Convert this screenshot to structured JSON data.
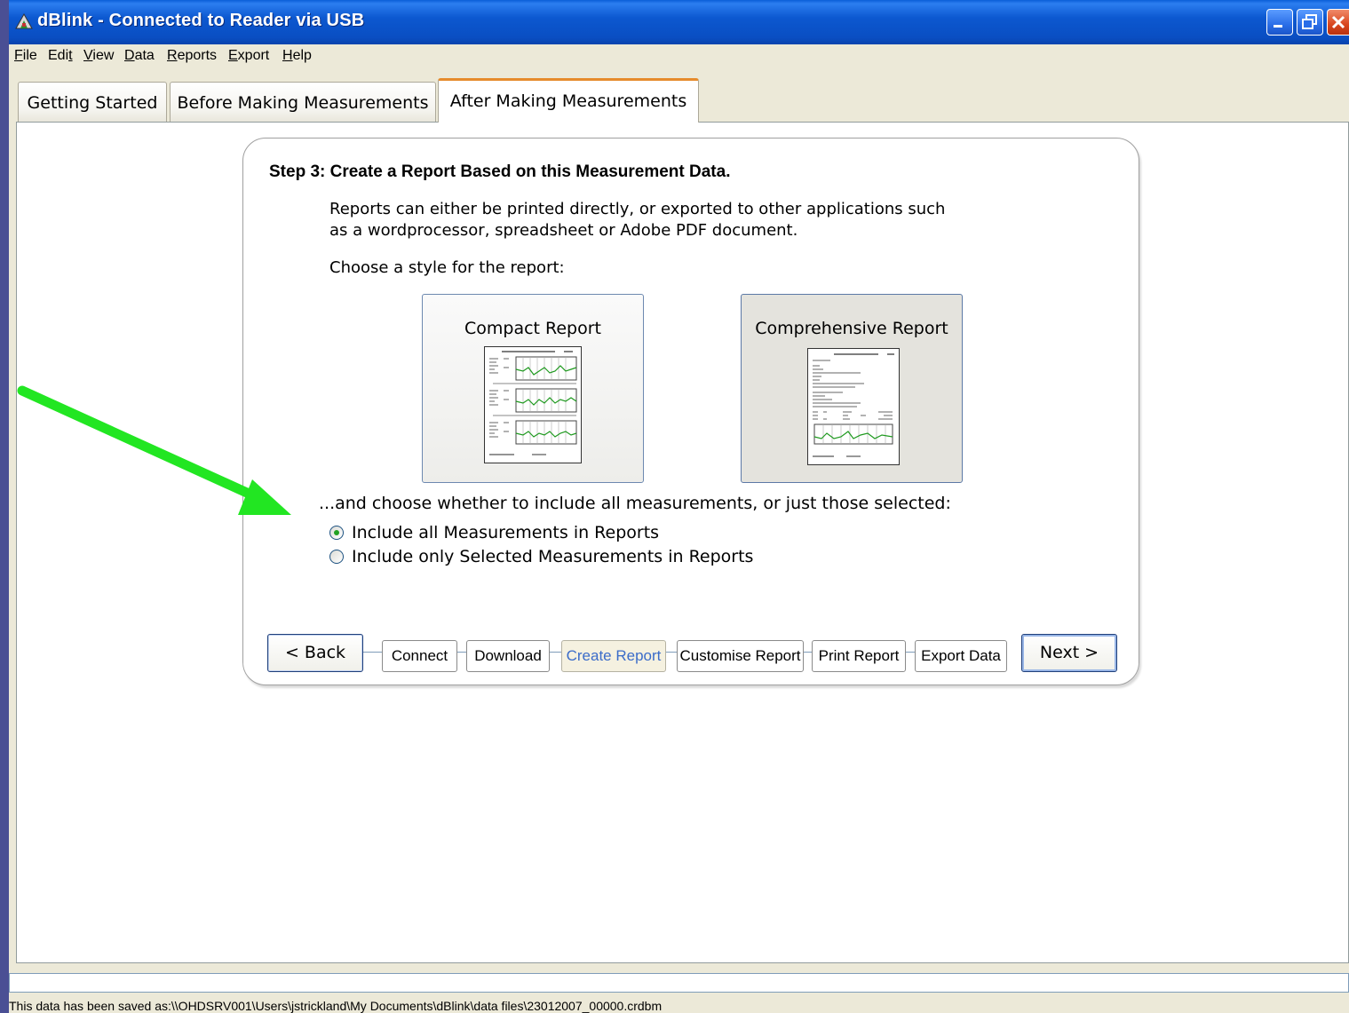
{
  "window": {
    "title": "dBlink - Connected to Reader via USB",
    "icons": [
      "app-icon",
      "minimize-icon",
      "maximize-icon",
      "close-icon"
    ]
  },
  "menu": [
    {
      "label": "File",
      "accel": "F",
      "rest": "ile"
    },
    {
      "label": "Edit",
      "accel": "",
      "rest": "Edit"
    },
    {
      "label": "View",
      "accel": "V",
      "rest": "iew"
    },
    {
      "label": "Data",
      "accel": "D",
      "rest": "ata"
    },
    {
      "label": "Reports",
      "accel": "R",
      "rest": "eports"
    },
    {
      "label": "Export",
      "accel": "E",
      "rest": "xport"
    },
    {
      "label": "Help",
      "accel": "H",
      "rest": "elp"
    }
  ],
  "tabs": [
    {
      "label": "Getting Started",
      "active": false
    },
    {
      "label": "Before Making Measurements",
      "active": false
    },
    {
      "label": "After Making Measurements",
      "active": true
    }
  ],
  "step": {
    "title": "Step 3: Create a Report Based on this Measurement Data.",
    "description_line1": "Reports can either be printed directly, or exported to other applications such",
    "description_line2": "as a wordprocessor, spreadsheet or Adobe PDF document.",
    "choose_style": "Choose a style for the report:",
    "report_styles": [
      {
        "label": "Compact Report",
        "selected": false
      },
      {
        "label": "Comprehensive Report",
        "selected": true
      }
    ],
    "include_prompt": "...and choose whether to include all measurements, or just those selected:",
    "include_options": [
      {
        "label": "Include all Measurements in Reports",
        "checked": true
      },
      {
        "label": "Include only Selected Measurements in Reports",
        "checked": false
      }
    ]
  },
  "nav": {
    "back": "< Back",
    "next": "Next >",
    "steps": [
      "Connect",
      "Download",
      "Create Report",
      "Customise Report",
      "Print Report",
      "Export Data"
    ],
    "current_step": "Create Report"
  },
  "status": {
    "saved_text": "This data has been saved as:\\\\OHDSRV001\\Users\\jstrickland\\My Documents\\dBlink\\data files\\23012007_00000.crdbm"
  },
  "colors": {
    "accent_arrow": "#22e622",
    "title_bar": "#0a4ec2",
    "active_tab_border": "#e68b2c",
    "current_step_text": "#3b6cc9"
  }
}
